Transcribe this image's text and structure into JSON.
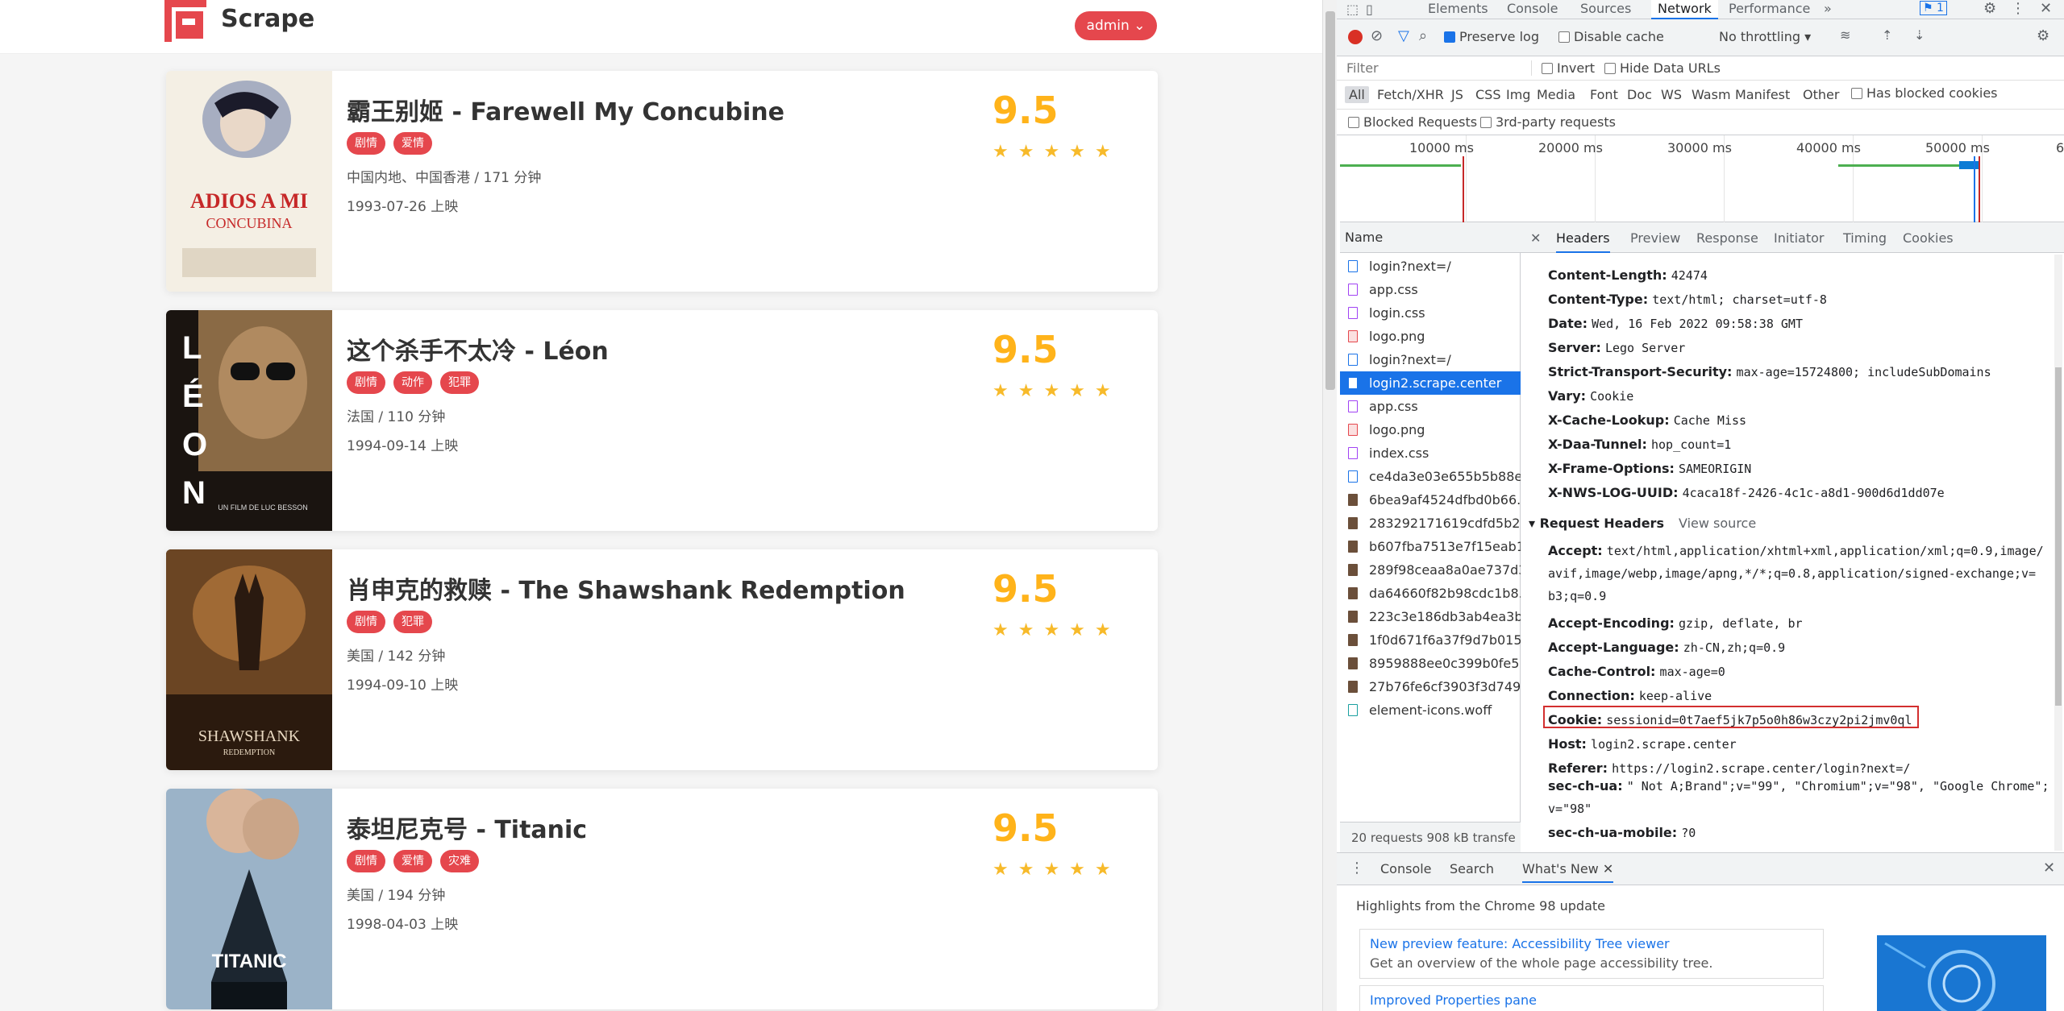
{
  "site": {
    "brand": "Scrape",
    "admin": "admin ⌄"
  },
  "movies": [
    {
      "title": "霸王别姬 - Farewell My Concubine",
      "tags": [
        "剧情",
        "爱情"
      ],
      "info": "中国内地、中国香港 / 171 分钟",
      "date": "1993-07-26 上映",
      "score": "9.5"
    },
    {
      "title": "这个杀手不太冷 - Léon",
      "tags": [
        "剧情",
        "动作",
        "犯罪"
      ],
      "info": "法国 / 110 分钟",
      "date": "1994-09-14 上映",
      "score": "9.5"
    },
    {
      "title": "肖申克的救赎 - The Shawshank Redemption",
      "tags": [
        "剧情",
        "犯罪"
      ],
      "info": "美国 / 142 分钟",
      "date": "1994-09-10 上映",
      "score": "9.5"
    },
    {
      "title": "泰坦尼克号 - Titanic",
      "tags": [
        "剧情",
        "爱情",
        "灾难"
      ],
      "info": "美国 / 194 分钟",
      "date": "1998-04-03 上映",
      "score": "9.5"
    }
  ],
  "posters": {
    "p1": "ADIOS A MI",
    "p1b": "CONCUBINA",
    "p2": "LÉON",
    "p2b": "UN FILM DE LUC BESSON",
    "p3": "SHAWSHANK",
    "p3b": "REDEMPTION",
    "p4": "TITANIC"
  },
  "devtools": {
    "tabs": [
      "Elements",
      "Console",
      "Sources",
      "Network",
      "Performance"
    ],
    "more": "»",
    "issues": "1",
    "preserve_log": "Preserve log",
    "disable_cache": "Disable cache",
    "throttling": "No throttling",
    "filter_placeholder": "Filter",
    "invert": "Invert",
    "hide_data": "Hide Data URLs",
    "types": [
      "All",
      "Fetch/XHR",
      "JS",
      "CSS",
      "Img",
      "Media",
      "Font",
      "Doc",
      "WS",
      "Wasm",
      "Manifest",
      "Other"
    ],
    "blocked_cookies": "Has blocked cookies",
    "blocked_requests": "Blocked Requests",
    "third_party": "3rd-party requests",
    "timeline": [
      "10000 ms",
      "20000 ms",
      "30000 ms",
      "40000 ms",
      "50000 ms",
      "6"
    ],
    "name_header": "Name",
    "requests": [
      {
        "name": "login?next=/",
        "type": "doc"
      },
      {
        "name": "app.css",
        "type": "css"
      },
      {
        "name": "login.css",
        "type": "css"
      },
      {
        "name": "logo.png",
        "type": "img"
      },
      {
        "name": "login?next=/",
        "type": "doc"
      },
      {
        "name": "login2.scrape.center",
        "type": "doc"
      },
      {
        "name": "app.css",
        "type": "css"
      },
      {
        "name": "logo.png",
        "type": "img"
      },
      {
        "name": "index.css",
        "type": "css"
      },
      {
        "name": "ce4da3e03e655b5b88e...",
        "type": "doc"
      },
      {
        "name": "6bea9af4524dfbd0b66...",
        "type": "pic"
      },
      {
        "name": "283292171619cdfd5b2...",
        "type": "pic"
      },
      {
        "name": "b607fba7513e7f15eab1...",
        "type": "pic"
      },
      {
        "name": "289f98ceaa8a0ae737d3...",
        "type": "pic"
      },
      {
        "name": "da64660f82b98cdc1b8...",
        "type": "pic"
      },
      {
        "name": "223c3e186db3ab4ea3b...",
        "type": "pic"
      },
      {
        "name": "1f0d671f6a37f9d7b015...",
        "type": "pic"
      },
      {
        "name": "8959888ee0c399b0fe5...",
        "type": "pic"
      },
      {
        "name": "27b76fe6cf3903f3d749...",
        "type": "pic"
      },
      {
        "name": "element-icons.woff",
        "type": "font"
      }
    ],
    "footer": "20 requests   908 kB transfe",
    "detail_tabs": [
      "Headers",
      "Preview",
      "Response",
      "Initiator",
      "Timing",
      "Cookies"
    ],
    "response_headers": [
      {
        "k": "Content-Length:",
        "v": "42474"
      },
      {
        "k": "Content-Type:",
        "v": "text/html; charset=utf-8"
      },
      {
        "k": "Date:",
        "v": "Wed, 16 Feb 2022 09:58:38 GMT"
      },
      {
        "k": "Server:",
        "v": "Lego Server"
      },
      {
        "k": "Strict-Transport-Security:",
        "v": "max-age=15724800; includeSubDomains"
      },
      {
        "k": "Vary:",
        "v": "Cookie"
      },
      {
        "k": "X-Cache-Lookup:",
        "v": "Cache Miss"
      },
      {
        "k": "X-Daa-Tunnel:",
        "v": "hop_count=1"
      },
      {
        "k": "X-Frame-Options:",
        "v": "SAMEORIGIN"
      },
      {
        "k": "X-NWS-LOG-UUID:",
        "v": "4caca18f-2426-4c1c-a8d1-900d6d1dd07e"
      }
    ],
    "request_section": "▾ Request Headers",
    "view_source": "View source",
    "accept_k": "Accept:",
    "accept_v1": "text/html,application/xhtml+xml,application/xml;q=0.9,image/",
    "accept_v2": "avif,image/webp,image/apng,*/*;q=0.8,application/signed-exchange;v=",
    "accept_v3": "b3;q=0.9",
    "request_headers": [
      {
        "k": "Accept-Encoding:",
        "v": "gzip, deflate, br"
      },
      {
        "k": "Accept-Language:",
        "v": "zh-CN,zh;q=0.9"
      },
      {
        "k": "Cache-Control:",
        "v": "max-age=0"
      },
      {
        "k": "Connection:",
        "v": "keep-alive"
      },
      {
        "k": "Cookie:",
        "v": "sessionid=0t7aef5jk7p5o0h86w3czy2pi2jmv0ql"
      },
      {
        "k": "Host:",
        "v": "login2.scrape.center"
      },
      {
        "k": "Referer:",
        "v": "https://login2.scrape.center/login?next=/"
      }
    ],
    "ua_k": "sec-ch-ua:",
    "ua_v1": "\" Not A;Brand\";v=\"99\", \"Chromium\";v=\"98\", \"Google Chrome\";",
    "ua_v2": "v=\"98\"",
    "mobile_k": "sec-ch-ua-mobile:",
    "mobile_v": "?0",
    "drawer_tabs": [
      "Console",
      "Search",
      "What's New"
    ],
    "highlights": "Highlights from the Chrome 98 update",
    "news1_title": "New preview feature: Accessibility Tree viewer",
    "news1_desc": "Get an overview of the whole page accessibility tree.",
    "news2_title": "Improved Properties pane"
  }
}
